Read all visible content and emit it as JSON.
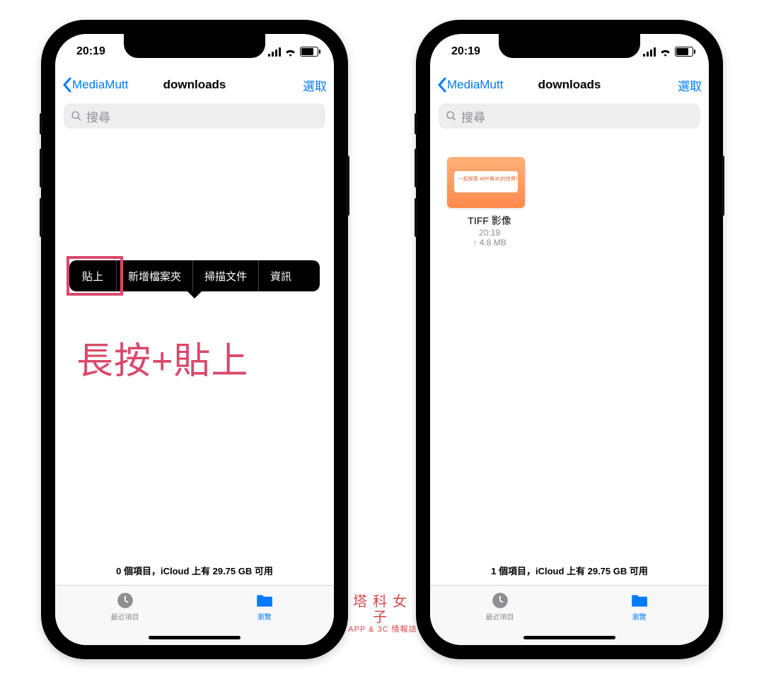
{
  "colors": {
    "accent": "#007AFF",
    "highlight": "#D9496B"
  },
  "annotation": "長按+貼上",
  "watermark": {
    "line1": "塔科女子",
    "line2": "APP & 3C 情報誌"
  },
  "status": {
    "time": "20:19"
  },
  "nav": {
    "back": "MediaMutt",
    "title": "downloads",
    "select": "選取"
  },
  "search": {
    "placeholder": "搜尋"
  },
  "left": {
    "context_menu": {
      "paste": "貼上",
      "new_folder": "新增檔案夾",
      "scan": "掃描文件",
      "info": "資訊"
    },
    "footer": "0 個項目，iCloud 上有 29.75 GB 可用"
  },
  "right": {
    "file": {
      "name": "TIFF 影像",
      "time": "20:19",
      "size": "↑ 4.8 MB",
      "thumb_text": "一起探索\nAPP與3C的世界！"
    },
    "footer": "1 個項目，iCloud 上有 29.75 GB 可用"
  },
  "tabs": {
    "recent": "最近項目",
    "browse": "瀏覽"
  }
}
